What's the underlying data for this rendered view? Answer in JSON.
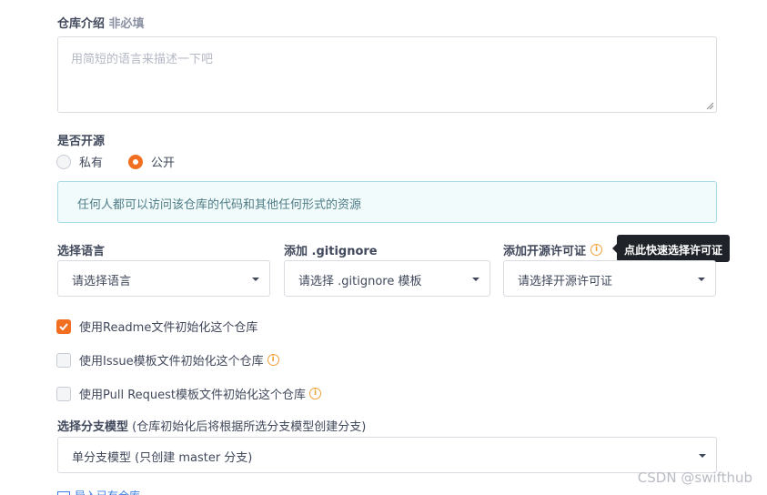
{
  "description": {
    "label": "仓库介绍",
    "optional_tag": "非必填",
    "placeholder": "用简短的语言来描述一下吧"
  },
  "open_source": {
    "label": "是否开源",
    "options": [
      {
        "label": "私有",
        "selected": false
      },
      {
        "label": "公开",
        "selected": true
      }
    ],
    "info_text": "任何人都可以访问该仓库的代码和其他任何形式的资源"
  },
  "language": {
    "label": "选择语言",
    "value": "请选择语言"
  },
  "gitignore": {
    "label": "添加 .gitignore",
    "value": "请选择 .gitignore 模板"
  },
  "license": {
    "label": "添加开源许可证",
    "value": "请选择开源许可证",
    "tooltip": "点此快速选择许可证"
  },
  "init_options": [
    {
      "label": "使用Readme文件初始化这个仓库",
      "checked": true,
      "has_info": false
    },
    {
      "label": "使用Issue模板文件初始化这个仓库",
      "checked": false,
      "has_info": true
    },
    {
      "label": "使用Pull Request模板文件初始化这个仓库",
      "checked": false,
      "has_info": true
    }
  ],
  "branch_model": {
    "label": "选择分支模型",
    "hint": "(仓库初始化后将根据所选分支模型创建分支)",
    "value": "单分支模型 (只创建 master 分支)"
  },
  "bottom_link": "导入已有仓库",
  "watermark": "CSDN @swifthub",
  "colors": {
    "accent": "#f26f21",
    "info_bg": "#f1fbfc",
    "info_border": "#a6dbe3",
    "tooltip_bg": "#1f2329"
  }
}
